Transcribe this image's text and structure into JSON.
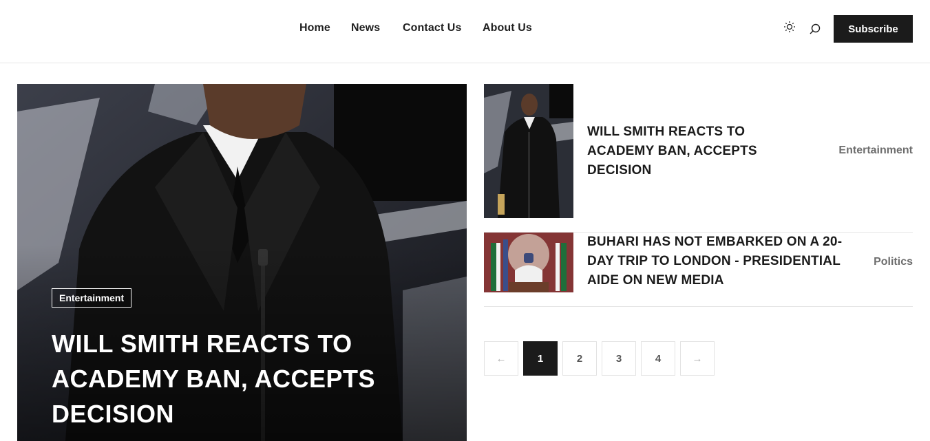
{
  "nav": {
    "items": [
      "Home",
      "News",
      "Contact Us",
      "About Us"
    ],
    "subscribe_label": "Subscribe"
  },
  "header_icons": [
    "sun-icon",
    "search-icon"
  ],
  "hero": {
    "category": "Entertainment",
    "title": "WILL SMITH REACTS TO ACADEMY BAN, ACCEPTS DECISION"
  },
  "posts": [
    {
      "title": "WILL SMITH REACTS TO ACADEMY BAN, ACCEPTS DECISION",
      "category": "Entertainment"
    },
    {
      "title": "BUHARI HAS NOT EMBARKED ON A 20-DAY TRIP TO LONDON - PRESIDENTIAL AIDE ON NEW MEDIA",
      "category": "Politics"
    }
  ],
  "pagination": {
    "prev": "←",
    "pages": [
      "1",
      "2",
      "3",
      "4"
    ],
    "current": "1",
    "next": "→"
  },
  "colors": {
    "primary": "#1b1b1b",
    "muted": "#6d6d6d",
    "border": "#e6e6e6"
  }
}
